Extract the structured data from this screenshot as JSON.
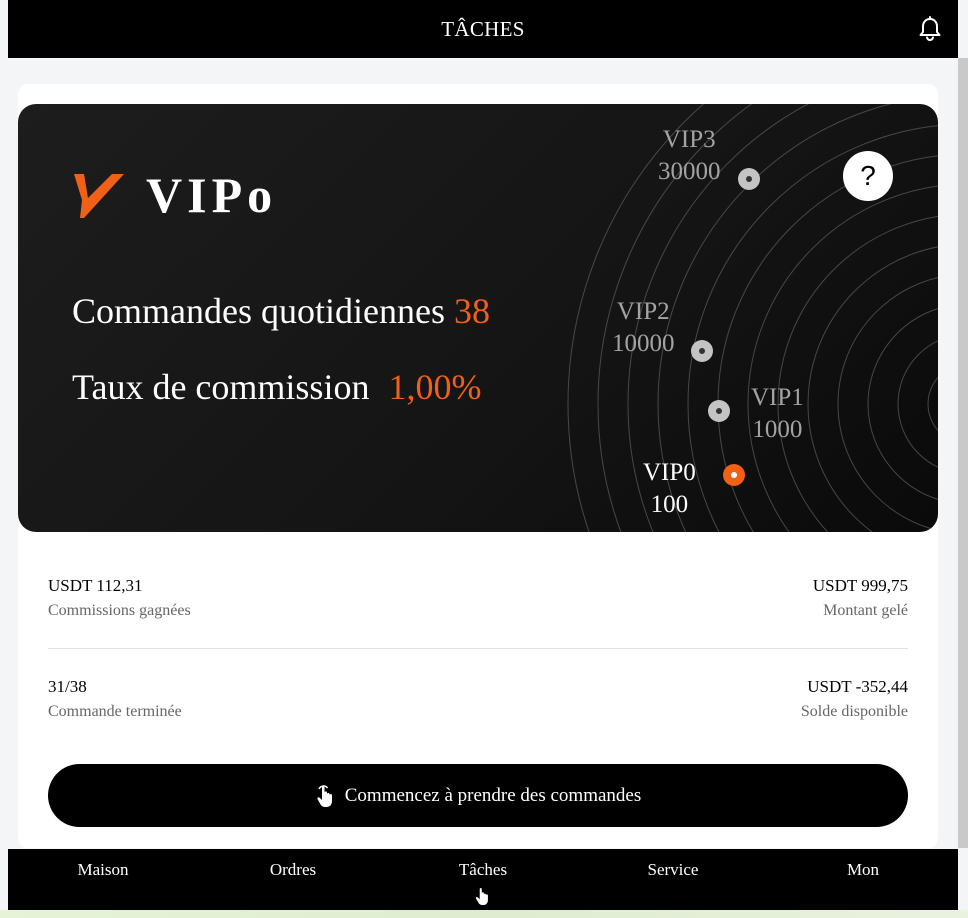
{
  "header": {
    "title": "TÂCHES",
    "bell_icon": "bell-icon"
  },
  "vip_card": {
    "brand": "VIPo",
    "logo_icon": "vipo-logo-icon",
    "daily_orders_label": "Commandes quotidiennes",
    "daily_orders_value": "38",
    "commission_label": "Taux de commission",
    "commission_value": "1,00%",
    "help_icon": "?",
    "accent_color": "#f06017",
    "levels": [
      {
        "name": "VIP3",
        "amount": "30000",
        "active": false
      },
      {
        "name": "VIP2",
        "amount": "10000",
        "active": false
      },
      {
        "name": "VIP1",
        "amount": "1000",
        "active": false
      },
      {
        "name": "VIP0",
        "amount": "100",
        "active": true
      }
    ]
  },
  "stats": {
    "commissions": {
      "amount": "USDT 112,31",
      "label": "Commissions gagnées"
    },
    "frozen": {
      "amount": "USDT 999,75",
      "label": "Montant gelé"
    },
    "completed": {
      "amount": "31/38",
      "label": "Commande terminée"
    },
    "balance": {
      "amount": "USDT -352,44",
      "label": "Solde disponible"
    }
  },
  "cta": {
    "label": "Commencez à prendre des commandes",
    "icon": "tap-hand-icon"
  },
  "nav": {
    "items": [
      {
        "label": "Maison"
      },
      {
        "label": "Ordres"
      },
      {
        "label": "Tâches",
        "active": true
      },
      {
        "label": "Service"
      },
      {
        "label": "Mon"
      }
    ]
  }
}
